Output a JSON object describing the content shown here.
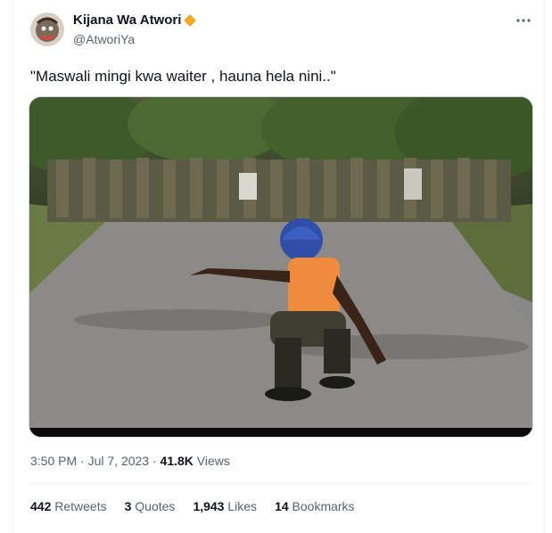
{
  "author": {
    "name": "Kijana Wa Atwori",
    "handle": "@AtworiYa"
  },
  "tweet": {
    "text": "\"Maswali mingi kwa waiter , hauna hela nini..\""
  },
  "meta": {
    "time": "3:50 PM",
    "separator": "·",
    "date": "Jul 7, 2023",
    "separator2": "·",
    "views_count": "41.8K",
    "views_label": "Views"
  },
  "stats": {
    "retweets_count": "442",
    "retweets_label": "Retweets",
    "quotes_count": "3",
    "quotes_label": "Quotes",
    "likes_count": "1,943",
    "likes_label": "Likes",
    "bookmarks_count": "14",
    "bookmarks_label": "Bookmarks"
  },
  "colors": {
    "verified_badge": "#f5a623",
    "text_primary": "#0f1419",
    "text_secondary": "#536471"
  },
  "icons": {
    "more": "more-options-icon",
    "verified": "verified-badge-icon"
  }
}
